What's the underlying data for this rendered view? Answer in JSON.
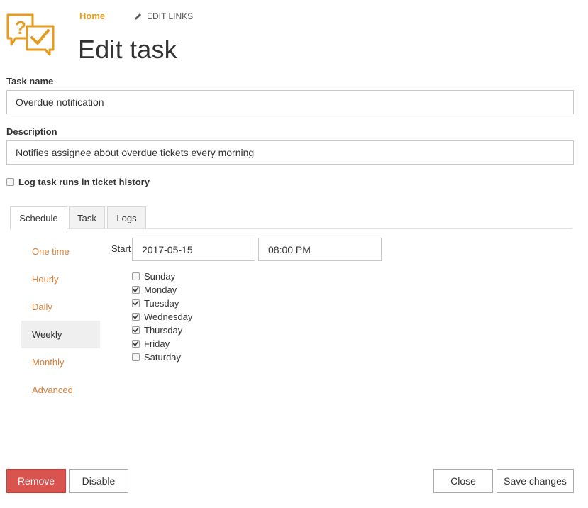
{
  "header": {
    "home_label": "Home",
    "edit_links_label": "EDIT LINKS",
    "title": "Edit task",
    "logo_icon": "question-check-bubbles-icon",
    "accent_color": "#e59b1f"
  },
  "form": {
    "task_name_label": "Task name",
    "task_name_value": "Overdue notification",
    "description_label": "Description",
    "description_value": "Notifies assignee about overdue tickets every morning",
    "log_runs_label": "Log task runs in ticket history",
    "log_runs_checked": false
  },
  "tabs": [
    {
      "label": "Schedule",
      "active": true
    },
    {
      "label": "Task",
      "active": false
    },
    {
      "label": "Logs",
      "active": false
    }
  ],
  "schedule": {
    "modes": [
      {
        "label": "One time",
        "active": false
      },
      {
        "label": "Hourly",
        "active": false
      },
      {
        "label": "Daily",
        "active": false
      },
      {
        "label": "Weekly",
        "active": true
      },
      {
        "label": "Monthly",
        "active": false
      },
      {
        "label": "Advanced",
        "active": false
      }
    ],
    "start_label": "Start",
    "start_date": "2017-05-15",
    "start_time": "08:00 PM",
    "days": [
      {
        "label": "Sunday",
        "checked": false
      },
      {
        "label": "Monday",
        "checked": true
      },
      {
        "label": "Tuesday",
        "checked": true
      },
      {
        "label": "Wednesday",
        "checked": true
      },
      {
        "label": "Thursday",
        "checked": true
      },
      {
        "label": "Friday",
        "checked": true
      },
      {
        "label": "Saturday",
        "checked": false
      }
    ]
  },
  "actions": {
    "remove_label": "Remove",
    "disable_label": "Disable",
    "close_label": "Close",
    "save_label": "Save changes",
    "danger_color": "#d9534f"
  }
}
